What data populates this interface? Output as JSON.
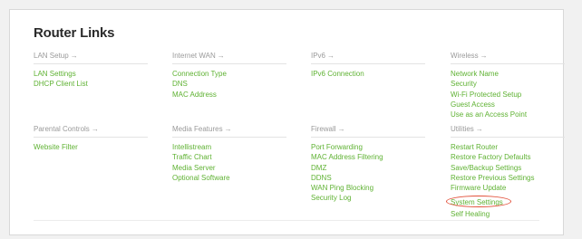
{
  "page": {
    "title": "Router Links"
  },
  "colors": {
    "link": "#5fb233",
    "heading": "#9a9a9a",
    "highlight": "#e2503a"
  },
  "sections": [
    {
      "heading": "LAN Setup",
      "arrow": "→",
      "links": [
        "LAN Settings",
        "DHCP Client List"
      ]
    },
    {
      "heading": "Internet WAN",
      "arrow": "→",
      "links": [
        "Connection Type",
        "DNS",
        "MAC Address"
      ]
    },
    {
      "heading": "IPv6",
      "arrow": "→",
      "links": [
        "IPv6 Connection"
      ]
    },
    {
      "heading": "Wireless",
      "arrow": "→",
      "links": [
        "Network Name",
        "Security",
        "Wi-Fi Protected Setup",
        "Guest Access",
        "Use as an Access Point"
      ]
    },
    {
      "heading": "Parental Controls",
      "arrow": "→",
      "links": [
        "Website Filter"
      ]
    },
    {
      "heading": "Media Features",
      "arrow": "→",
      "links": [
        "Intellistream",
        "Traffic Chart",
        "Media Server",
        "Optional Software"
      ]
    },
    {
      "heading": "Firewall",
      "arrow": "→",
      "links": [
        "Port Forwarding",
        "MAC Address Filtering",
        "DMZ",
        "DDNS",
        "WAN Ping Blocking",
        "Security Log"
      ]
    },
    {
      "heading": "Utilities",
      "arrow": "→",
      "links": [
        "Restart Router",
        "Restore Factory Defaults",
        "Save/Backup Settings",
        "Restore Previous Settings",
        "Firmware Update",
        "System Settings",
        "Self Healing"
      ]
    }
  ],
  "highlighted_link": "System Settings"
}
